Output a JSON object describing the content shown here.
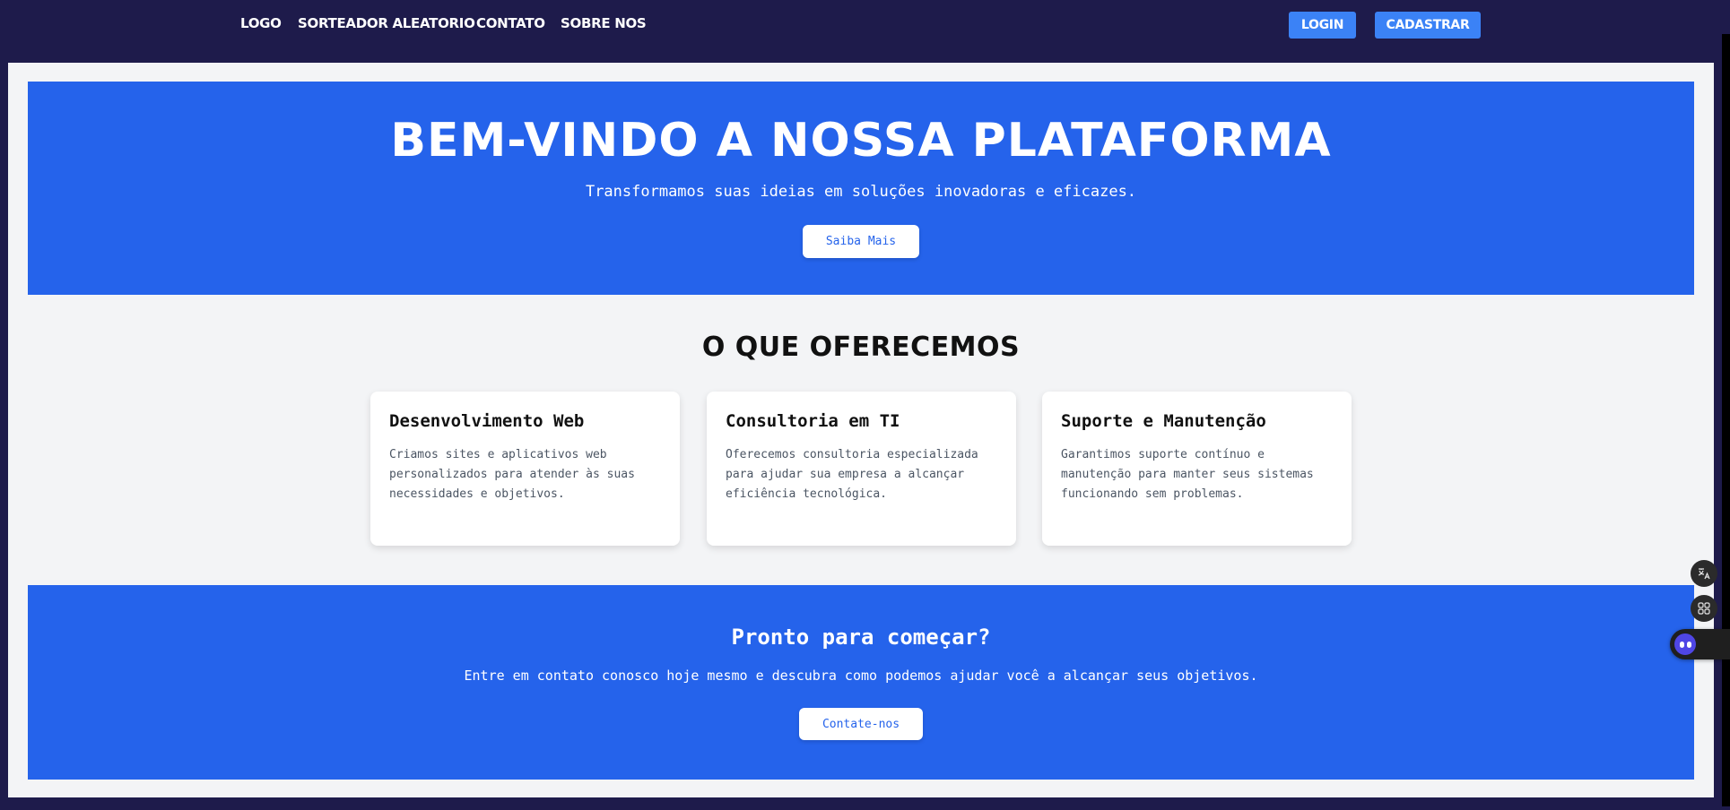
{
  "nav": {
    "links": [
      "LOGO",
      "SORTEADOR ALEATORIO",
      "CONTATO",
      "SOBRE NOS"
    ],
    "login_label": "LOGIN",
    "signup_label": "CADASTRAR"
  },
  "hero": {
    "title": "BEM-VINDO A NOSSA PLATAFORMA",
    "subtitle": "Transformamos suas ideias em soluções inovadoras e eficazes.",
    "button_label": "Saiba Mais"
  },
  "services": {
    "title": "O QUE OFERECEMOS",
    "cards": [
      {
        "title": "Desenvolvimento Web",
        "text": "Criamos sites e aplicativos web personalizados para atender às suas necessidades e objetivos."
      },
      {
        "title": "Consultoria em TI",
        "text": "Oferecemos consultoria especializada para ajudar sua empresa a alcançar eficiência tecnológica."
      },
      {
        "title": "Suporte e Manutenção",
        "text": "Garantimos suporte contínuo e manutenção para manter seus sistemas funcionando sem problemas."
      }
    ]
  },
  "cta": {
    "title": "Pronto para começar?",
    "text": "Entre em contato conosco hoje mesmo e descubra como podemos ajudar você a alcançar seus objetivos.",
    "button_label": "Contate-nos"
  },
  "floating": {
    "icons": [
      "translate-icon",
      "apps-icon",
      "assistant-icon"
    ]
  },
  "colors": {
    "navbar": "#1e1b4b",
    "primary": "#2563eb",
    "nav_button": "#3b82f6",
    "page_bg": "#f3f4f6"
  }
}
